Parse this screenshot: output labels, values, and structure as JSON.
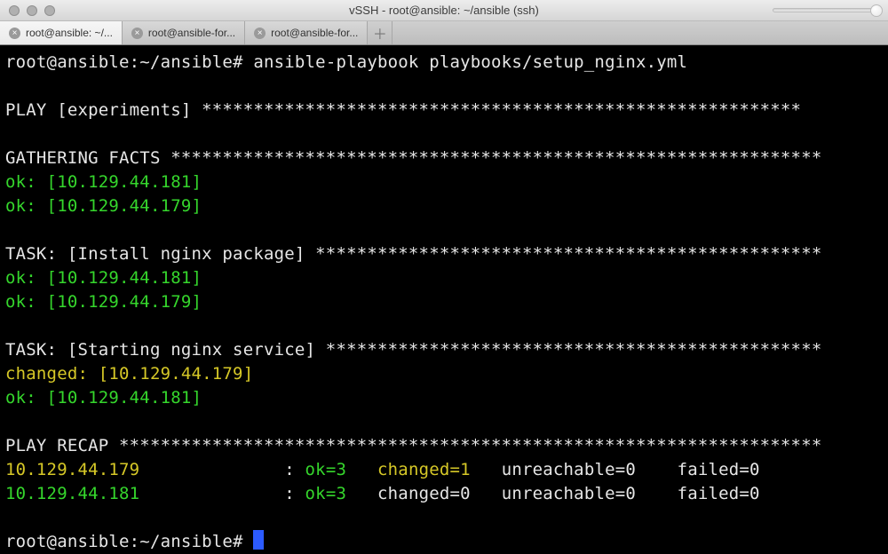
{
  "window": {
    "title": "vSSH - root@ansible: ~/ansible (ssh)"
  },
  "tabs": [
    {
      "label": "root@ansible: ~/...",
      "active": true
    },
    {
      "label": "root@ansible-for...",
      "active": false
    },
    {
      "label": "root@ansible-for...",
      "active": false
    }
  ],
  "term": {
    "prompt1": "root@ansible:~/ansible# ",
    "command": "ansible-playbook playbooks/setup_nginx.yml",
    "blank": "",
    "play_header": "PLAY [experiments] ********************************************************** ",
    "gather_header": "GATHERING FACTS *************************************************************** ",
    "ok_181": "ok: [10.129.44.181]",
    "ok_179": "ok: [10.129.44.179]",
    "task1_header": "TASK: [Install nginx package] ************************************************* ",
    "task1_ok_181": "ok: [10.129.44.181]",
    "task1_ok_179": "ok: [10.129.44.179]",
    "task2_header": "TASK: [Starting nginx service] ************************************************ ",
    "task2_changed_179": "changed: [10.129.44.179]",
    "task2_ok_181": "ok: [10.129.44.181]",
    "recap_header": "PLAY RECAP ******************************************************************** ",
    "recap1_host": "10.129.44.179",
    "recap1_pad": "              ",
    "recap1_colon": ": ",
    "recap1_ok": "ok=3   ",
    "recap1_changed": "changed=1   ",
    "recap1_rest": "unreachable=0    failed=0   ",
    "recap2_host": "10.129.44.181",
    "recap2_pad": "              ",
    "recap2_colon": ": ",
    "recap2_ok": "ok=3   ",
    "recap2_changed": "changed=0   ",
    "recap2_rest": "unreachable=0    failed=0   ",
    "prompt2": "root@ansible:~/ansible# "
  }
}
